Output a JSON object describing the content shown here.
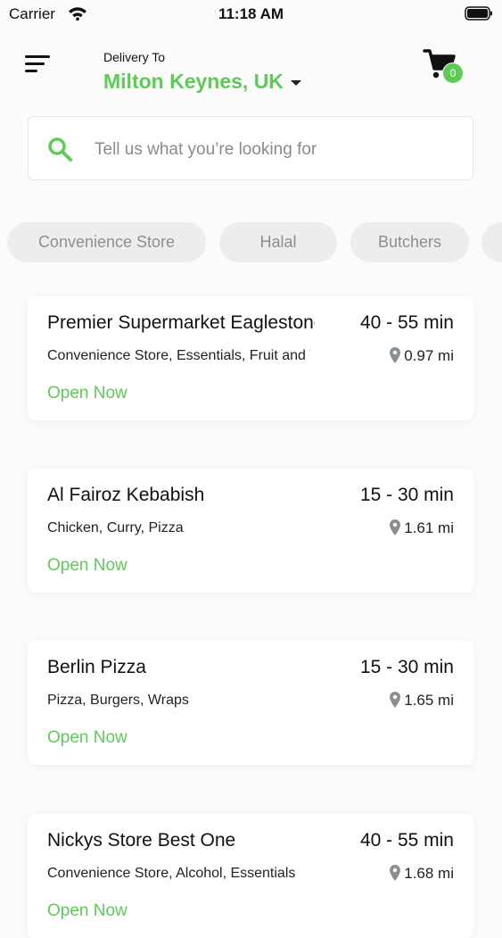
{
  "status_bar": {
    "carrier": "Carrier",
    "time": "11:18 AM"
  },
  "header": {
    "delivery_label": "Delivery To",
    "location": "Milton Keynes, UK",
    "cart_count": "0"
  },
  "search": {
    "placeholder": "Tell us what you’re looking for"
  },
  "categories": [
    "Convenience Store",
    "Halal",
    "Butchers"
  ],
  "stores": [
    {
      "name": "Premier Supermarket Eaglestone",
      "delivery_time": "40 - 55 min",
      "tags": "Convenience Store, Essentials, Fruit and Veg",
      "distance": "0.97 mi",
      "status": "Open Now"
    },
    {
      "name": "Al Fairoz Kebabish",
      "delivery_time": "15 - 30 min",
      "tags": "Chicken, Curry, Pizza",
      "distance": "1.61 mi",
      "status": "Open Now"
    },
    {
      "name": "Berlin Pizza",
      "delivery_time": "15 - 30 min",
      "tags": "Pizza, Burgers, Wraps",
      "distance": "1.65 mi",
      "status": "Open Now"
    },
    {
      "name": "Nickys Store Best One",
      "delivery_time": "40 - 55 min",
      "tags": "Convenience Store, Alcohol, Essentials",
      "distance": "1.68 mi",
      "status": "Open Now"
    }
  ],
  "colors": {
    "accent": "#5ecb58",
    "chip_bg": "#eceeee",
    "chip_text": "#8e8e8e"
  },
  "icons": {
    "menu": "menu-icon",
    "cart": "cart-icon",
    "search": "search-icon",
    "location": "location-pin-icon"
  }
}
